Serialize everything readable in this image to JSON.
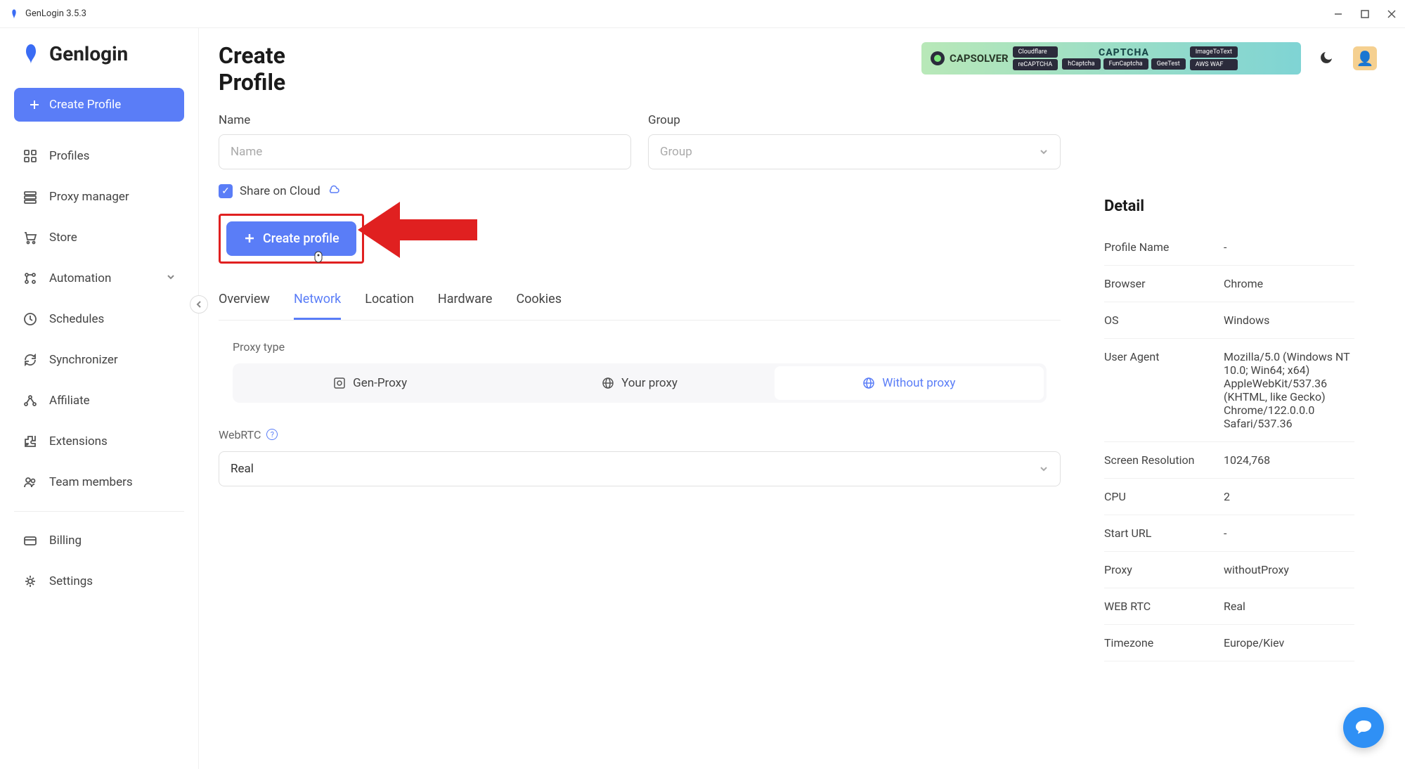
{
  "titlebar": {
    "app_name": "GenLogin 3.5.3"
  },
  "brand": {
    "name": "Genlogin"
  },
  "sidebar": {
    "create_btn": "Create Profile",
    "items": [
      {
        "label": "Profiles"
      },
      {
        "label": "Proxy manager"
      },
      {
        "label": "Store"
      },
      {
        "label": "Automation"
      },
      {
        "label": "Schedules"
      },
      {
        "label": "Synchronizer"
      },
      {
        "label": "Affiliate"
      },
      {
        "label": "Extensions"
      },
      {
        "label": "Team members"
      },
      {
        "label": "Billing"
      },
      {
        "label": "Settings"
      }
    ]
  },
  "page": {
    "title_line1": "Create",
    "title_line2": "Profile"
  },
  "banner": {
    "logo": "CAPSOLVER",
    "chips_left": [
      "Cloudflare",
      "reCAPTCHA"
    ],
    "center": "CAPTCHA",
    "chips_mid": [
      "hCaptcha",
      "FunCaptcha",
      "GeeTest"
    ],
    "chips_right": [
      "ImageToText",
      "AWS WAF"
    ]
  },
  "form": {
    "name_label": "Name",
    "name_placeholder": "Name",
    "group_label": "Group",
    "group_placeholder": "Group",
    "share_cloud": "Share on Cloud",
    "create_btn": "Create profile"
  },
  "tabs": [
    "Overview",
    "Network",
    "Location",
    "Hardware",
    "Cookies"
  ],
  "active_tab": "Network",
  "network": {
    "proxy_type_label": "Proxy type",
    "proxy_options": [
      "Gen-Proxy",
      "Your proxy",
      "Without proxy"
    ],
    "proxy_selected": "Without proxy",
    "webrtc_label": "WebRTC",
    "webrtc_value": "Real"
  },
  "detail": {
    "title": "Detail",
    "rows": [
      {
        "k": "Profile Name",
        "v": "-"
      },
      {
        "k": "Browser",
        "v": "Chrome"
      },
      {
        "k": "OS",
        "v": "Windows"
      },
      {
        "k": "User Agent",
        "v": "Mozilla/5.0 (Windows NT 10.0; Win64; x64) AppleWebKit/537.36 (KHTML, like Gecko) Chrome/122.0.0.0 Safari/537.36"
      },
      {
        "k": "Screen Resolution",
        "v": "1024,768"
      },
      {
        "k": "CPU",
        "v": "2"
      },
      {
        "k": "Start URL",
        "v": "-"
      },
      {
        "k": "Proxy",
        "v": "withoutProxy"
      },
      {
        "k": "WEB RTC",
        "v": "Real"
      },
      {
        "k": "Timezone",
        "v": "Europe/Kiev"
      }
    ]
  }
}
